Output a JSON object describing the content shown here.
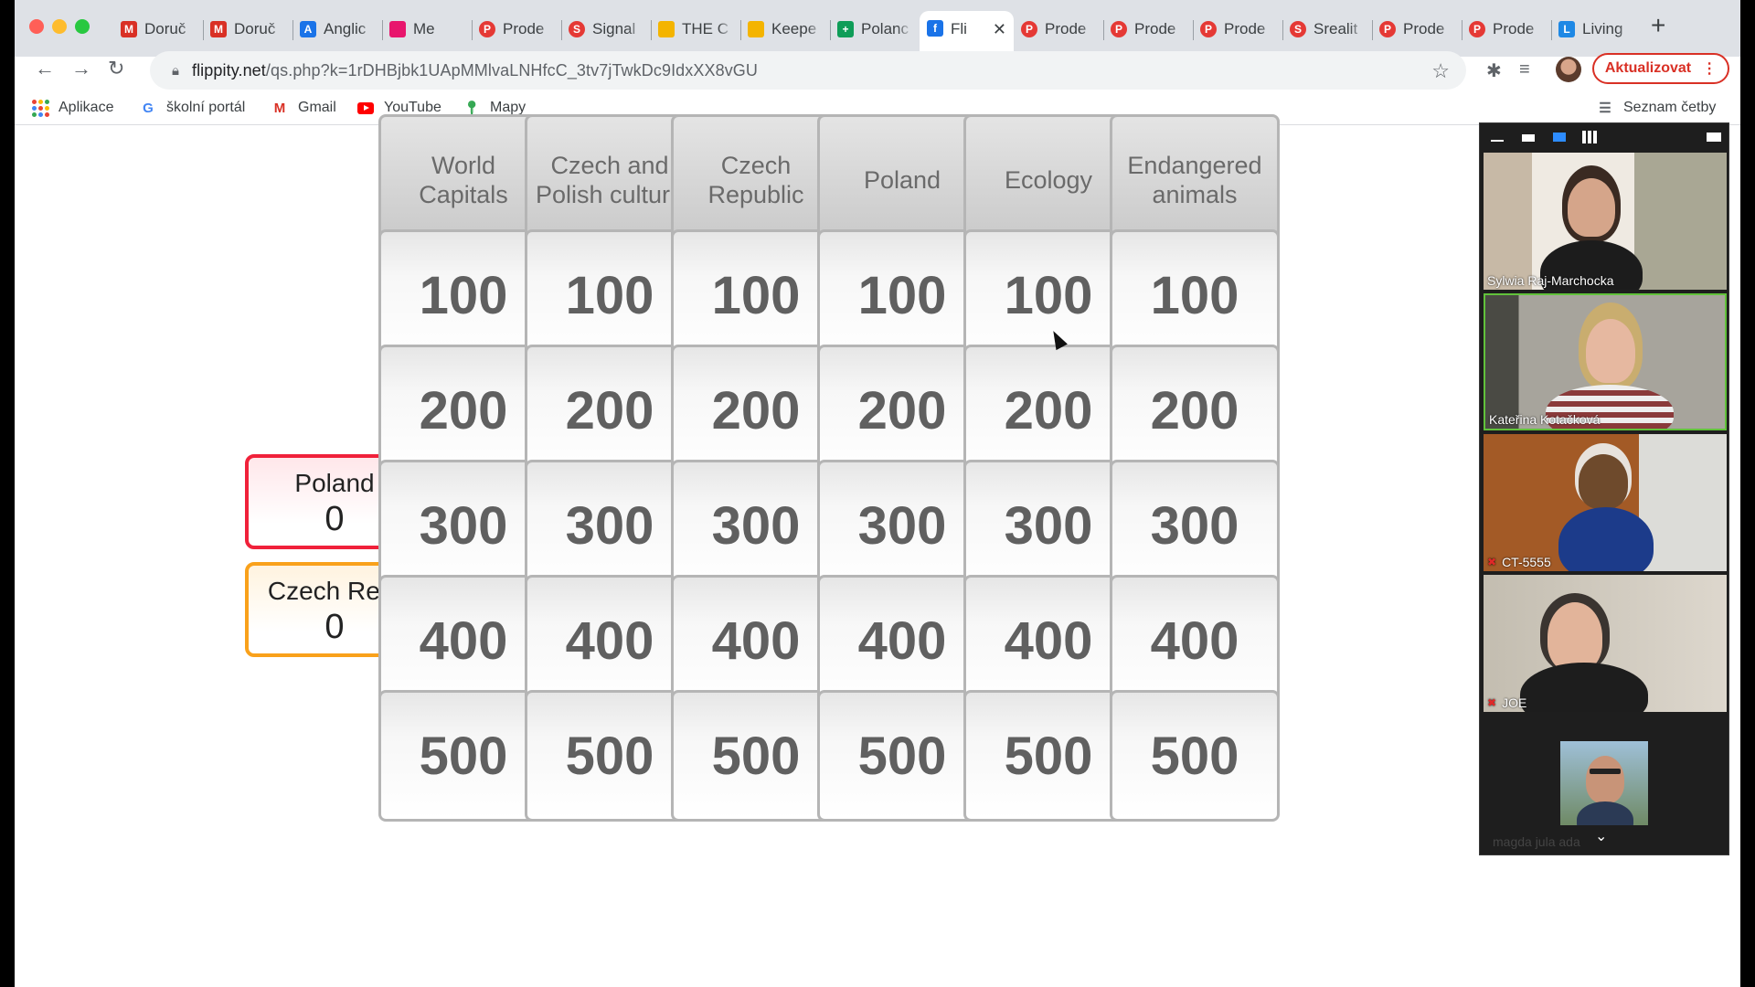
{
  "browser": {
    "tabs": [
      {
        "label": "Doruč",
        "icon": "gmail-icon",
        "color": "#d93025",
        "glyph": "M"
      },
      {
        "label": "Doruč",
        "icon": "gmail-icon",
        "color": "#d93025",
        "glyph": "M"
      },
      {
        "label": "Anglic",
        "icon": "contacts-icon",
        "color": "#1a73e8",
        "glyph": "A"
      },
      {
        "label": "Me",
        "icon": "meet-icon",
        "color": "#e8166d",
        "glyph": ""
      },
      {
        "label": "Prode",
        "icon": "prode-icon",
        "color": "#e53935",
        "glyph": "P"
      },
      {
        "label": "Signal",
        "icon": "signal-icon",
        "color": "#e53935",
        "glyph": "S"
      },
      {
        "label": "THE C",
        "icon": "keep-icon",
        "color": "#f4b400",
        "glyph": ""
      },
      {
        "label": "Keepe",
        "icon": "keep-icon",
        "color": "#f4b400",
        "glyph": ""
      },
      {
        "label": "Polanc",
        "icon": "sheets-icon",
        "color": "#0f9d58",
        "glyph": "+"
      },
      {
        "label": "Fli",
        "icon": "flippity-icon",
        "color": "#1a73e8",
        "glyph": "f",
        "active": true
      },
      {
        "label": "Prode",
        "icon": "prode-icon",
        "color": "#e53935",
        "glyph": "P"
      },
      {
        "label": "Prode",
        "icon": "prode-icon",
        "color": "#e53935",
        "glyph": "P"
      },
      {
        "label": "Prode",
        "icon": "prode-icon",
        "color": "#e53935",
        "glyph": "P"
      },
      {
        "label": "Srealit",
        "icon": "prode-icon",
        "color": "#e53935",
        "glyph": "S"
      },
      {
        "label": "Prode",
        "icon": "prode-icon",
        "color": "#e53935",
        "glyph": "P"
      },
      {
        "label": "Prode",
        "icon": "prode-icon",
        "color": "#e53935",
        "glyph": "P"
      },
      {
        "label": "Living",
        "icon": "living-icon",
        "color": "#1e88e5",
        "glyph": "L"
      }
    ],
    "url_domain": "flippity.net",
    "url_path": "/qs.php?k=1rDHBjbk1UApMMlvaLNHfcC_3tv7jTwkDc9IdxXX8vGU",
    "update_label": "Aktualizovat",
    "bookmarks": [
      {
        "label": "Aplikace",
        "icon": "apps-icon"
      },
      {
        "label": "školní portál",
        "icon": "google-icon"
      },
      {
        "label": "Gmail",
        "icon": "gmail-icon"
      },
      {
        "label": "YouTube",
        "icon": "youtube-icon"
      },
      {
        "label": "Mapy",
        "icon": "maps-icon"
      }
    ],
    "reading_list_label": "Seznam četby"
  },
  "teams": [
    {
      "name": "Poland",
      "score": "0",
      "color": "#f0213a"
    },
    {
      "name": "Czech Rep.",
      "score": "0",
      "color": "#f9a11b"
    }
  ],
  "board": {
    "categories": [
      "World Capitals",
      "Czech and Polish culture",
      "Czech Republic",
      "Poland",
      "Ecology",
      "Endangered animals"
    ],
    "values": [
      "100",
      "200",
      "300",
      "400",
      "500"
    ]
  },
  "call": {
    "participants": [
      {
        "name": "Sylwia Raj-Marchocka",
        "muted": false
      },
      {
        "name": "Kateřina Kotačková",
        "muted": false
      },
      {
        "name": "CT-5555",
        "muted": true
      },
      {
        "name": "JOE",
        "muted": true
      },
      {
        "name": "magda jula ada",
        "muted": true
      }
    ]
  }
}
